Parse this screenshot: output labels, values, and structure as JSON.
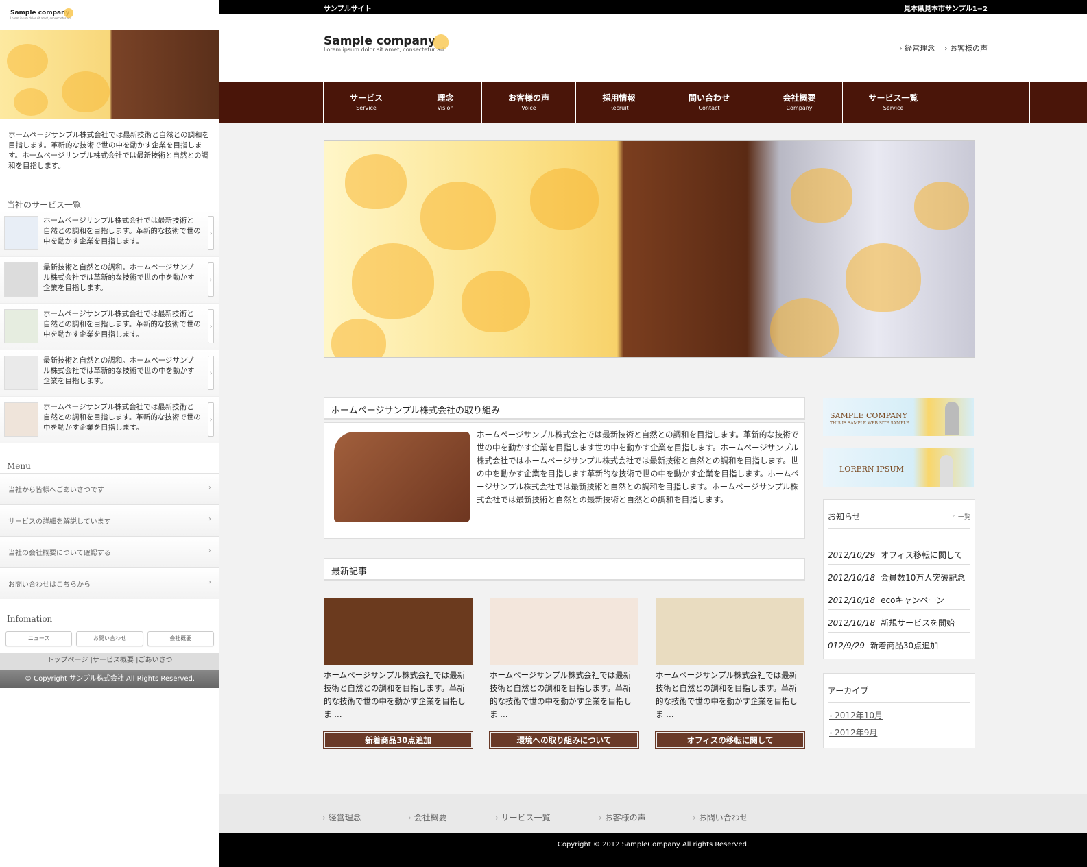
{
  "left": {
    "logo": "Sample company",
    "logo_sub": "Lorem ipsum dolor sit amet, consectetur ad",
    "hero_alt": "",
    "intro": "ホームページサンプル株式会社では最新技術と自然との調和を目指します。革新的な技術で世の中を動かす企業を目指します。ホームページサンプル株式会社では最新技術と自然との調和を目指します。",
    "services_heading": "当社のサービス一覧",
    "services": [
      {
        "text": "ホームページサンプル株式会社では最新技術と自然との調和を目指します。革新的な技術で世の中を動かす企業を目指します。",
        "thumb": "#e8eef6"
      },
      {
        "text": "最新技術と自然との調和。ホームページサンプル株式会社では革新的な技術で世の中を動かす企業を目指します。",
        "thumb": "#dcdcdc"
      },
      {
        "text": "ホームページサンプル株式会社では最新技術と自然との調和を目指します。革新的な技術で世の中を動かす企業を目指します。",
        "thumb": "#e6ede0"
      },
      {
        "text": "最新技術と自然との調和。ホームページサンプル株式会社では革新的な技術で世の中を動かす企業を目指します。",
        "thumb": "#eaeaea"
      },
      {
        "text": "ホームページサンプル株式会社では最新技術と自然との調和を目指します。革新的な技術で世の中を動かす企業を目指します。",
        "thumb": "#efe4da"
      }
    ],
    "menu_heading": "Menu",
    "menu": [
      "当社から皆様へごあいさつです",
      "サービスの詳細を解説しています",
      "当社の会社概要について確認する",
      "お問い合わせはこちらから"
    ],
    "info_heading": "Infomation",
    "info_buttons": [
      "ニュース",
      "お問い合わせ",
      "会社概要"
    ],
    "footer_links": "トップページ  |サービス概要  |ごあいさつ",
    "copyright": "© Copyright サンプル株式会社 All Rights Reserved."
  },
  "topbar": {
    "left": "サンプルサイト",
    "right": "見本県見本市サンプル1−2"
  },
  "header": {
    "logo": "Sample company",
    "logo_sub": "Lorem ipsum dolor sit amet, consectetur ad",
    "links": [
      "経営理念",
      "お客様の声"
    ]
  },
  "nav": [
    {
      "ja": "サービス",
      "en": "Service",
      "w": 125
    },
    {
      "ja": "理念",
      "en": "Vision",
      "w": 106
    },
    {
      "ja": "お客様の声",
      "en": "Voice",
      "w": 137
    },
    {
      "ja": "採用情報",
      "en": "Recruit",
      "w": 126
    },
    {
      "ja": "問い合わせ",
      "en": "Contact",
      "w": 137
    },
    {
      "ja": "会社概要",
      "en": "Company",
      "w": 126
    },
    {
      "ja": "サービス一覧",
      "en": "Service",
      "w": 148
    },
    {
      "ja": "",
      "en": "",
      "w": 125
    }
  ],
  "intro": {
    "title": "ホームページサンプル株式会社の取り組み",
    "text": "ホームページサンプル株式会社では最新技術と自然との調和を目指します。革新的な技術で世の中を動かす企業を目指します世の中を動かす企業を目指します。ホームページサンプル株式会社ではホームページサンプル株式会社では最新技術と自然との調和を目指します。世の中を動かす企業を目指します革新的な技術で世の中を動かす企業を目指します。ホームページサンプル株式会社では最新技術と自然との調和を目指します。ホームページサンプル株式会社では最新技術と自然との最新技術と自然との調和を目指します。"
  },
  "latest": {
    "title": "最新記事",
    "articles": [
      {
        "text": "ホームページサンプル株式会社では最新技術と自然との調和を目指します。革新的な技術で世の中を動かす企業を目指しま …",
        "button": "新着商品30点追加",
        "img": "#6b3a1e"
      },
      {
        "text": "ホームページサンプル株式会社では最新技術と自然との調和を目指します。革新的な技術で世の中を動かす企業を目指しま …",
        "button": "環境への取り組みについて",
        "img": "#f3e6dc"
      },
      {
        "text": "ホームページサンプル株式会社では最新技術と自然との調和を目指します。革新的な技術で世の中を動かす企業を目指しま …",
        "button": "オフィスの移転に関して",
        "img": "#e9dcc0"
      }
    ]
  },
  "banners": [
    {
      "title": "SAMPLE COMPANY",
      "sub": "THIS IS SAMPLE WEB SITE SAMPLE"
    },
    {
      "title": "LORERN IPSUM",
      "sub": ""
    }
  ],
  "news": {
    "title": "お知らせ",
    "more": "一覧",
    "items": [
      {
        "date": "2012/10/29",
        "text": "オフィス移転に関して"
      },
      {
        "date": "2012/10/18",
        "text": "会員数10万人突破記念"
      },
      {
        "date": "2012/10/18",
        "text": "ecoキャンペーン"
      },
      {
        "date": "2012/10/18",
        "text": "新規サービスを開始"
      },
      {
        "date": "012/9/29",
        "text": "新着商品30点追加"
      }
    ]
  },
  "archive": {
    "title": "アーカイブ",
    "items": [
      "2012年10月",
      "2012年9月"
    ]
  },
  "footer": {
    "links": [
      "経営理念",
      "会社概要",
      "サービス一覧",
      "お客様の声",
      "お問い合わせ"
    ],
    "copyright": "Copyright © 2012 SampleCompany All rights Reserved."
  },
  "colors": {
    "nav_bg": "#4a1509",
    "button_bg": "#6a3a28",
    "accent_heart": "#f9c74f"
  }
}
